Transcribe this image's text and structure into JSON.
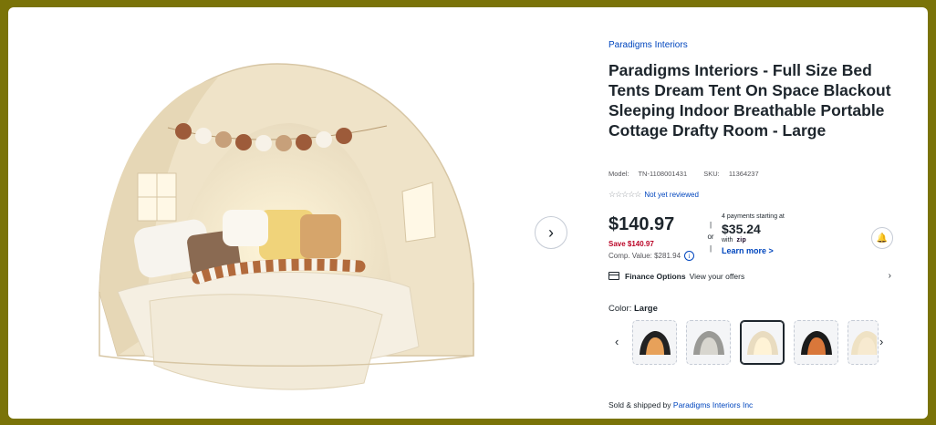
{
  "product": {
    "brand": "Paradigms Interiors",
    "title": "Paradigms Interiors - Full Size Bed Tents Dream Tent On Space Blackout Sleeping Indoor Breathable Portable Cottage Drafty Room - Large",
    "model_label": "Model:",
    "model": "TN-1108001431",
    "sku_label": "SKU:",
    "sku": "11364237",
    "rating_text": "Not yet reviewed",
    "stars": "☆☆☆☆☆"
  },
  "pricing": {
    "price": "$140.97",
    "save": "Save $140.97",
    "comp_value": "Comp. Value: $281.94",
    "or": "or",
    "pay_start": "4 payments starting at",
    "pay_amount": "$35.24",
    "pay_with": "with",
    "pay_provider": "zip",
    "learn_more": "Learn more >"
  },
  "finance": {
    "label": "Finance Options",
    "link": "View your offers",
    "chevron": "›"
  },
  "color": {
    "label": "Color:",
    "value": "Large",
    "swatches": [
      {
        "name": "black",
        "selected": false
      },
      {
        "name": "gray",
        "selected": false
      },
      {
        "name": "beige",
        "selected": true
      },
      {
        "name": "black-orange",
        "selected": false
      },
      {
        "name": "cream",
        "selected": false
      }
    ]
  },
  "seller": {
    "prefix": "Sold & shipped by",
    "name": "Paradigms Interiors Inc"
  },
  "icons": {
    "next_image": "›",
    "prev_swatch": "‹",
    "next_swatch": "›",
    "info": "i",
    "bell": "🔔"
  },
  "colors": {
    "frame_bg": "#7a7308",
    "link_blue": "#0046be",
    "save_red": "#bb0628"
  }
}
